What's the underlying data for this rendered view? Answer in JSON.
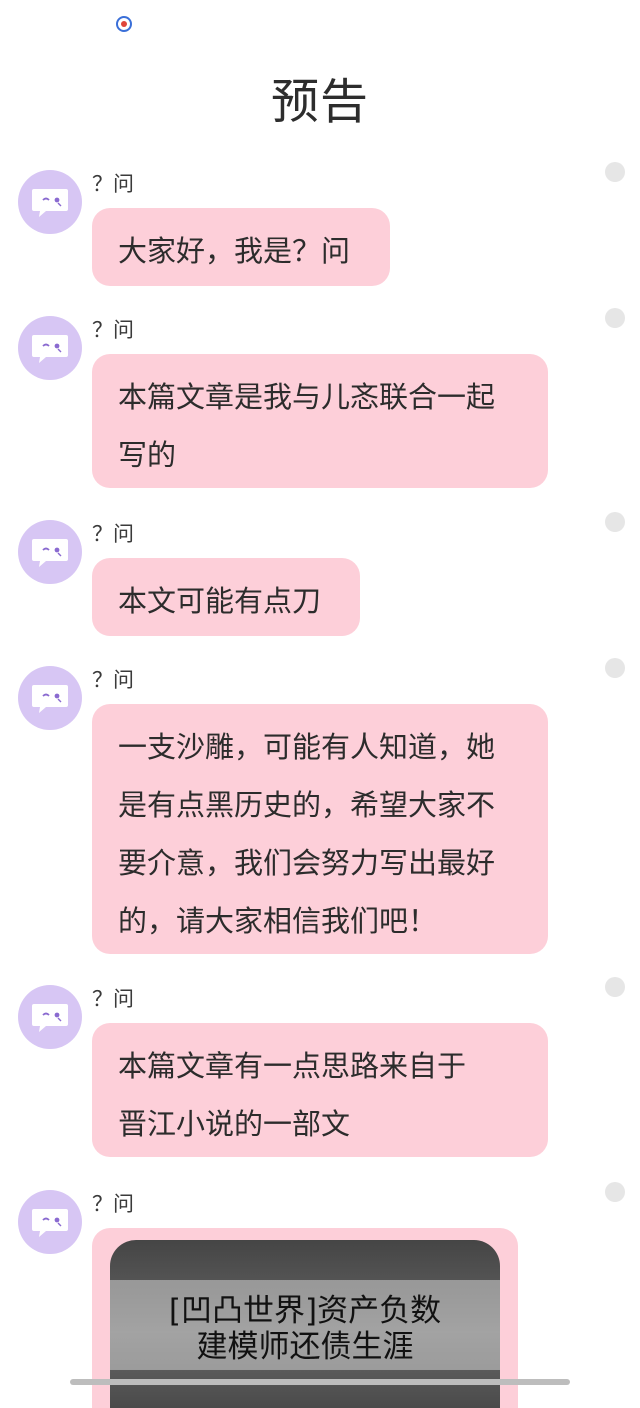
{
  "header": {
    "title": "预告"
  },
  "colors": {
    "bubble": "#fdcfd9",
    "avatar": "#d7c6f4",
    "side_dot": "#e6e6e6"
  },
  "messages": [
    {
      "sender": "？问",
      "text": "大家好，我是？问"
    },
    {
      "sender": "？问",
      "text": "本篇文章是我与儿忞联合一起\n写的"
    },
    {
      "sender": "？问",
      "text": "本文可能有点刀"
    },
    {
      "sender": "？问",
      "text": "一支沙雕，可能有人知道，她\n是有点黑历史的，希望大家不\n要介意，我们会努力写出最好\n的，请大家相信我们吧！"
    },
    {
      "sender": "？问",
      "text": "本篇文章有一点思路来自于\n晋江小说的一部文"
    },
    {
      "sender": "？问",
      "image": {
        "line1": "[凹凸世界]资产负数",
        "line2": "建模师还债生涯"
      }
    }
  ]
}
